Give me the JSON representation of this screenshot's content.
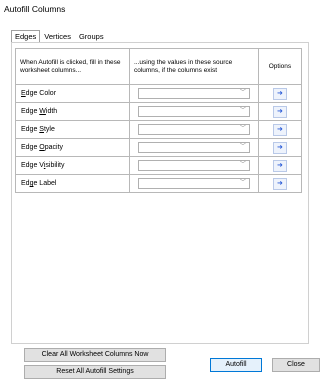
{
  "window": {
    "title": "Autofill Columns"
  },
  "tabs": [
    {
      "label": "Edges"
    },
    {
      "label": "Vertices"
    },
    {
      "label": "Groups"
    }
  ],
  "grid": {
    "headers": [
      "When Autofill is clicked, fill in these worksheet columns...",
      "...using the values in these source columns, if the columns exist",
      "Options"
    ],
    "rows": [
      {
        "label_pre": "",
        "label_u": "E",
        "label_post": "dge Color",
        "source": ""
      },
      {
        "label_pre": "Edge ",
        "label_u": "W",
        "label_post": "idth",
        "source": ""
      },
      {
        "label_pre": "Edge ",
        "label_u": "S",
        "label_post": "tyle",
        "source": ""
      },
      {
        "label_pre": "Edge ",
        "label_u": "O",
        "label_post": "pacity",
        "source": ""
      },
      {
        "label_pre": "Edge V",
        "label_u": "i",
        "label_post": "sibility",
        "source": ""
      },
      {
        "label_pre": "Ed",
        "label_u": "g",
        "label_post": "e Label",
        "source": ""
      }
    ],
    "combo_arrow": "﹀",
    "options_icon": "➜"
  },
  "buttons": {
    "clear_label": "Clear All Worksheet Columns Now",
    "reset_label": "Reset All Autofill Settings",
    "autofill_label": "Autofill",
    "close_label": "Close"
  }
}
